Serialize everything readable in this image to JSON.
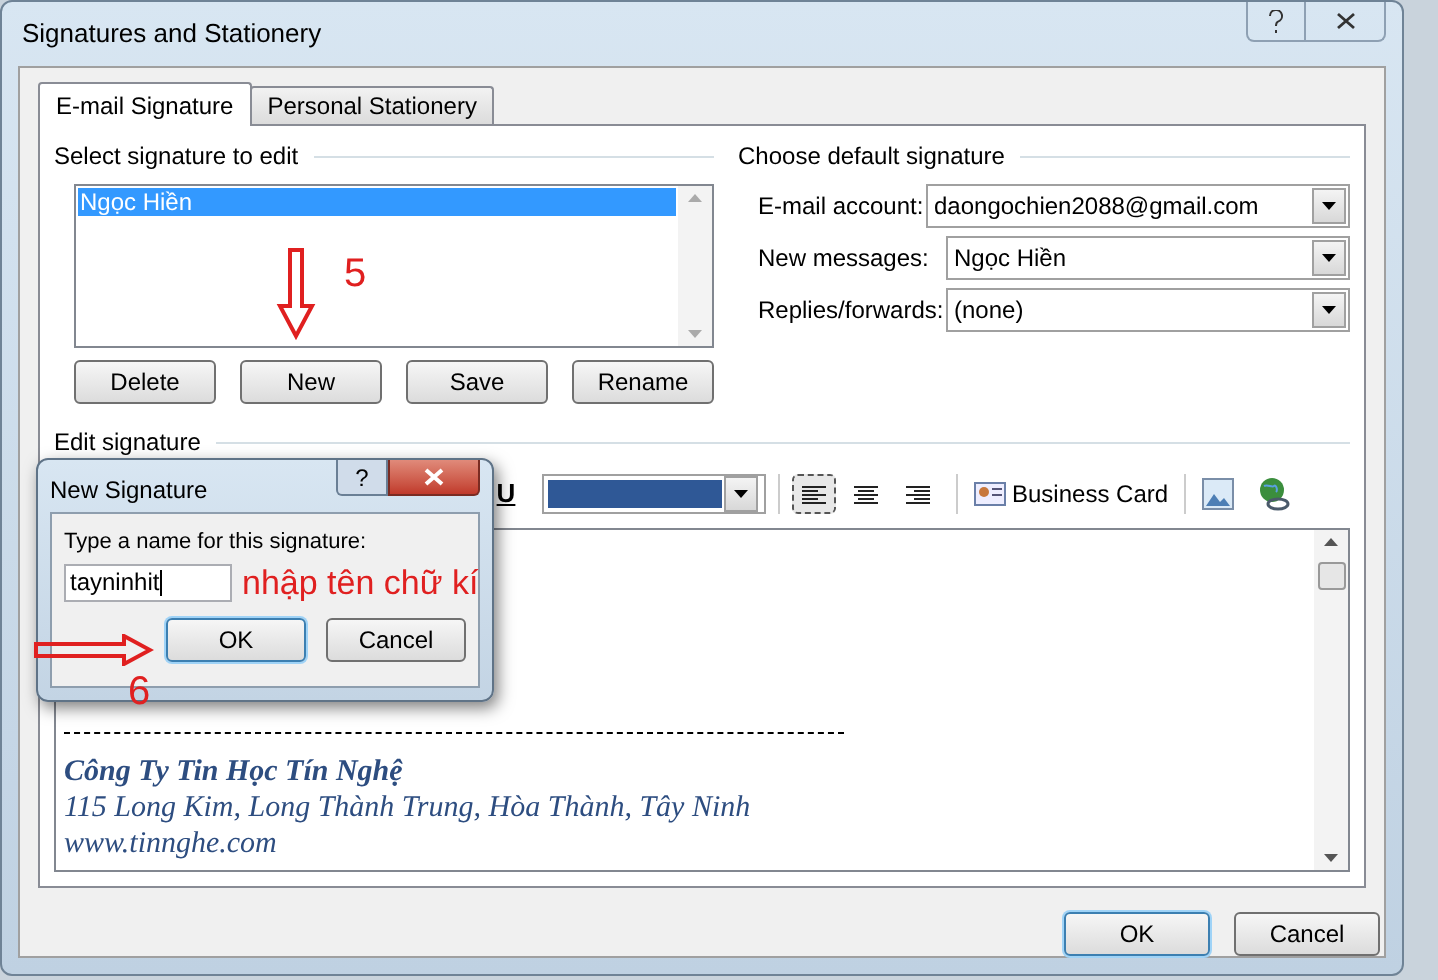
{
  "window": {
    "title": "Signatures and Stationery"
  },
  "tabs": [
    {
      "label": "E-mail Signature",
      "selected": true
    },
    {
      "label": "Personal Stationery",
      "selected": false
    }
  ],
  "select_signature": {
    "heading": "Select signature to edit",
    "items": [
      {
        "label": "Ngọc Hiền",
        "selected": true
      }
    ],
    "buttons": [
      "Delete",
      "New",
      "Save",
      "Rename"
    ]
  },
  "default_signature": {
    "heading": "Choose default signature",
    "fields": [
      {
        "label": "E-mail account:",
        "value": "daongochien2088@gmail.com"
      },
      {
        "label": "New messages:",
        "value": "Ngọc Hiền"
      },
      {
        "label": "Replies/forwards:",
        "value": "(none)"
      }
    ]
  },
  "edit_signature": {
    "heading": "Edit signature",
    "underline": "U",
    "business_card": "Business Card",
    "lines": [
      {
        "text": "Công Ty Tin Học Tín Nghệ",
        "bold": true
      },
      {
        "text": "115 Long Kim, Long Thành Trung, Hòa Thành, Tây Ninh",
        "bold": false
      },
      {
        "text": "www.tinnghe.com",
        "bold": false
      }
    ]
  },
  "footer_buttons": [
    "OK",
    "Cancel"
  ],
  "new_signature_dialog": {
    "title": "New Signature",
    "help": "?",
    "prompt": "Type a name for this signature:",
    "value": "tayninhit",
    "buttons": [
      "OK",
      "Cancel"
    ]
  },
  "annotations": [
    {
      "kind": "step",
      "text": "5"
    },
    {
      "kind": "step",
      "text": "6"
    },
    {
      "kind": "note",
      "text": "nhập tên chữ kí"
    }
  ]
}
